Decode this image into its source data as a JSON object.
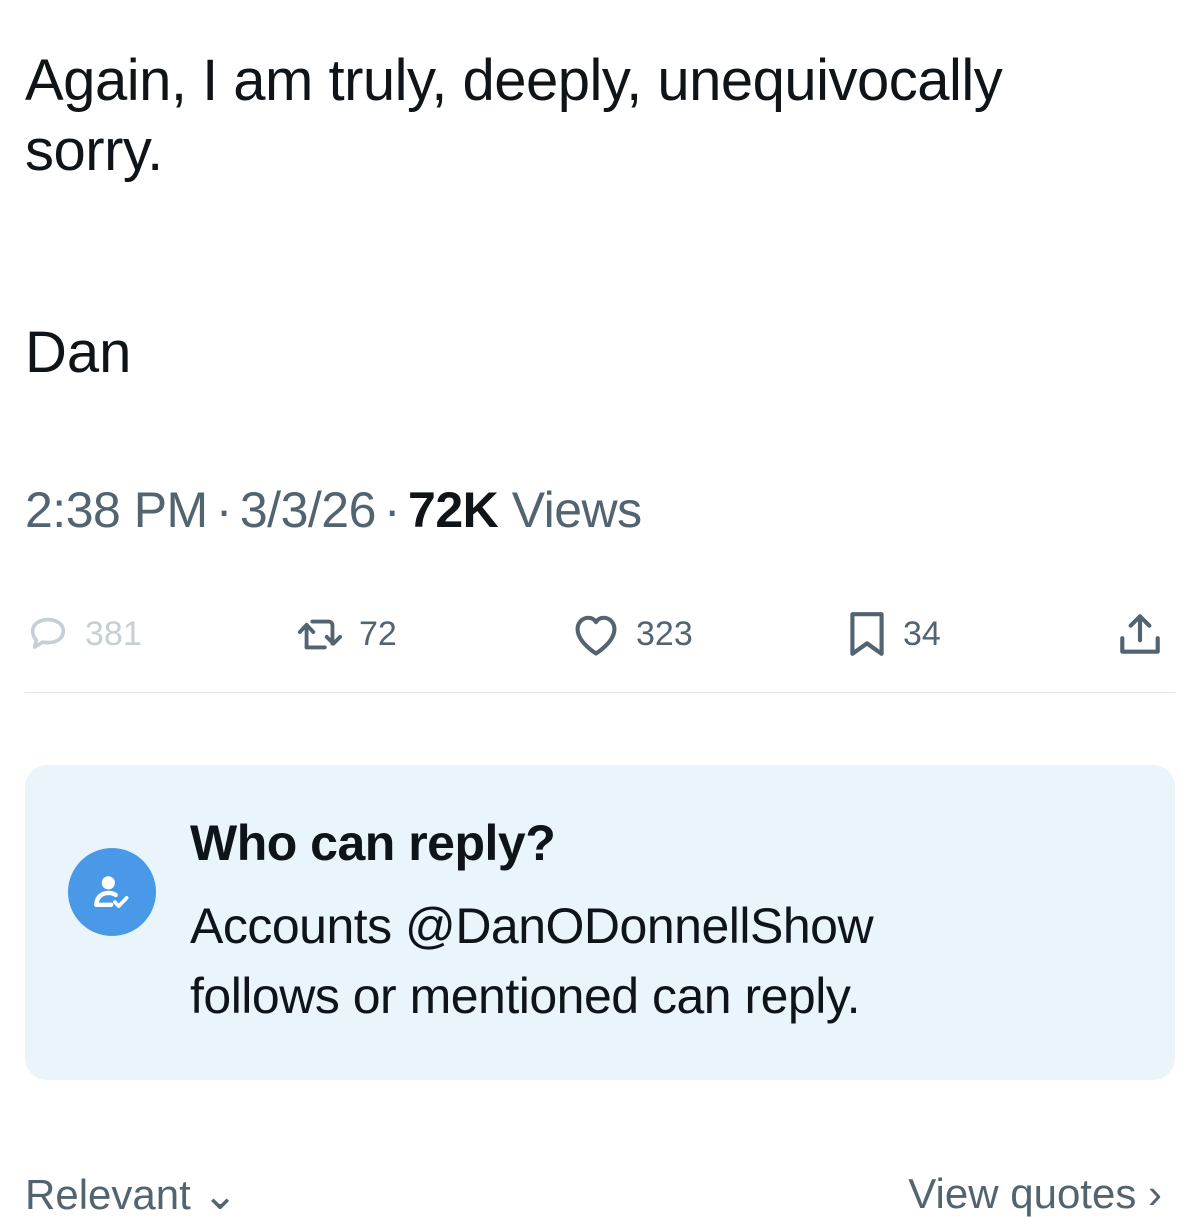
{
  "tweet": {
    "text_line_1": "Again, I am truly, deeply, unequivocally",
    "text_line_2": "sorry.",
    "signature": "Dan"
  },
  "meta": {
    "time": "2:38 PM",
    "separator": "·",
    "date": "3/3/26",
    "views_count": "72K",
    "views_label": "Views"
  },
  "actions": {
    "replies": "381",
    "retweets": "72",
    "likes": "323",
    "bookmarks": "34",
    "reply_icon": "reply-bubble-icon",
    "retweet_icon": "retweet-icon",
    "like_icon": "heart-icon",
    "bookmark_icon": "bookmark-icon",
    "share_icon": "share-icon"
  },
  "who_can_reply": {
    "title": "Who can reply?",
    "description_line_1": "Accounts @DanODonnellShow",
    "description_line_2": "follows or mentioned can reply.",
    "icon": "user-check-icon"
  },
  "footer": {
    "sort_label": "Relevant",
    "sort_icon": "chevron-down-icon",
    "quotes_label": "View quotes",
    "quotes_icon": "chevron-right-icon"
  },
  "colors": {
    "text": "#0f1419",
    "secondary": "#536471",
    "accent": "#4a99e9",
    "box_background": "#eaf4fb"
  }
}
